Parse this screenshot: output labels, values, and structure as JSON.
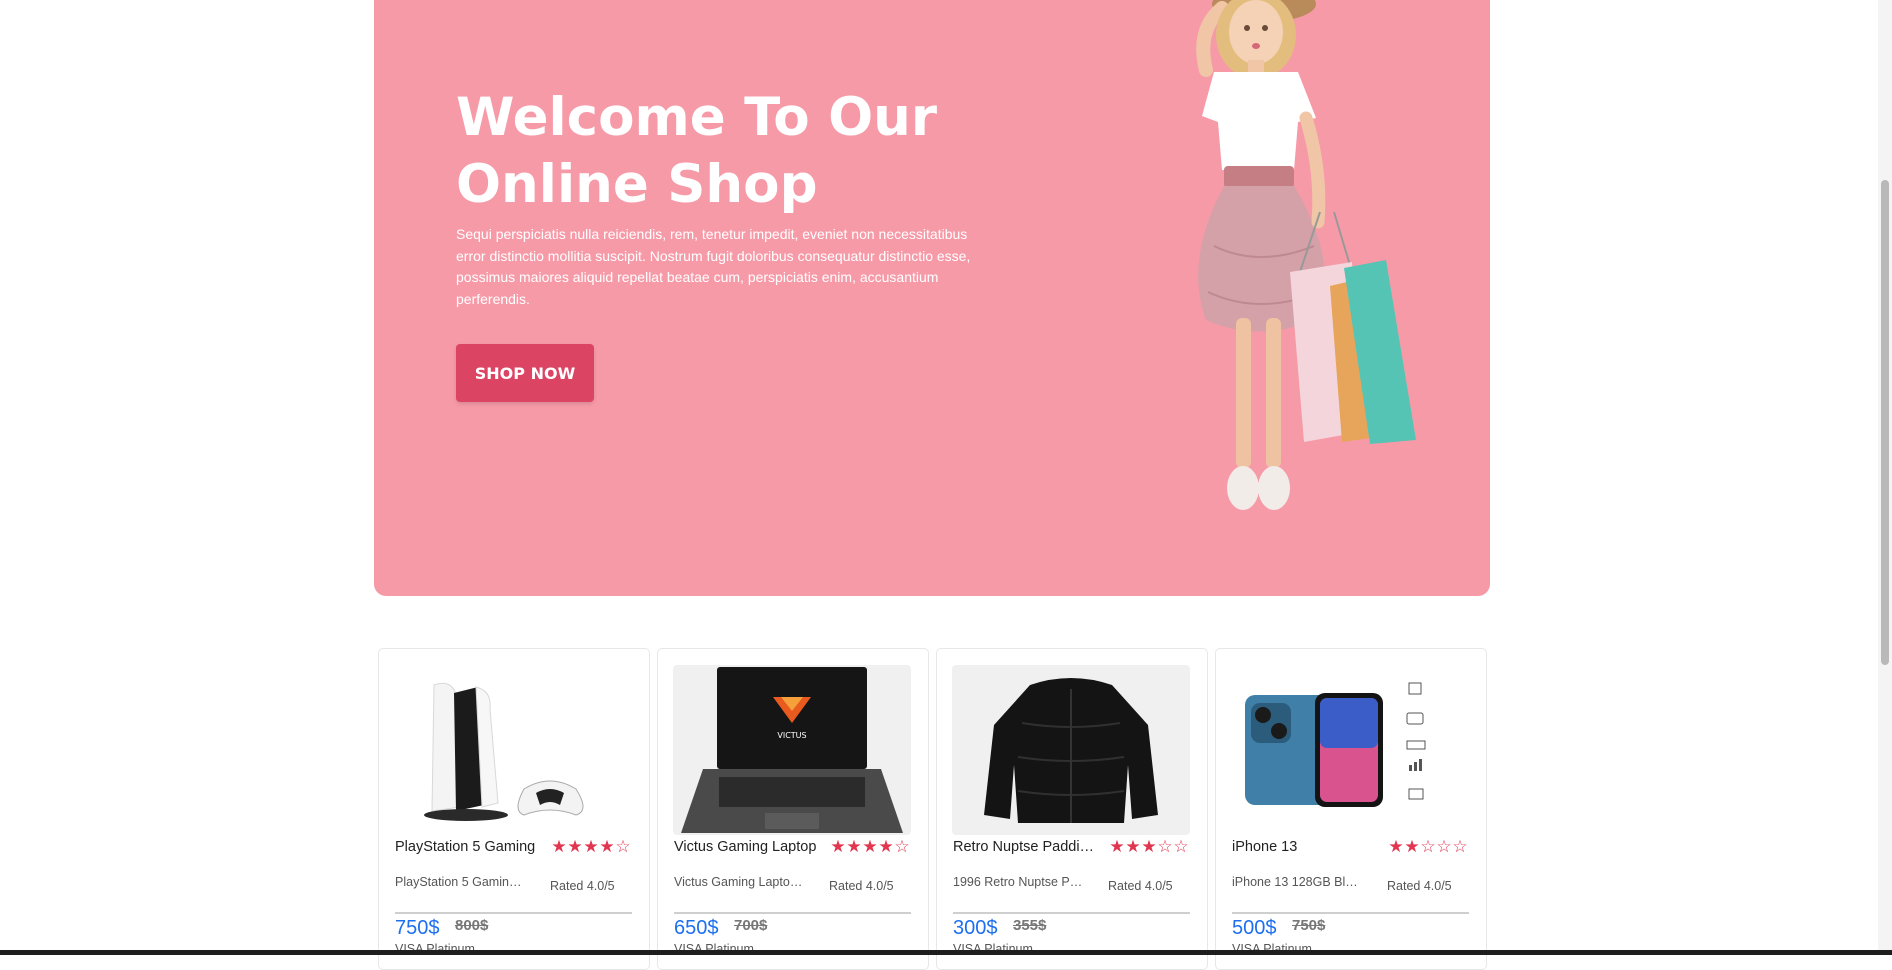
{
  "hero": {
    "title": "Welcome To Our Online Shop",
    "description": "Sequi perspiciatis nulla reiciendis, rem, tenetur impedit, eveniet non necessitatibus error distinctio mollitia suscipit. Nostrum fugit doloribus consequatur distinctio esse, possimus maiores aliquid repellat beatae cum, perspiciatis enim, accusantium perferendis.",
    "cta_label": "SHOP NOW",
    "background_color": "#f79aa8",
    "cta_color": "#dc4464"
  },
  "products": [
    {
      "name": "PlayStation 5 Gaming",
      "description": "PlayStation 5 Gaming...",
      "rating_stars": 4,
      "rated_label": "Rated 4.0/5",
      "price": "750$",
      "old_price": "800$",
      "payment": "VISA Platinum",
      "image_icon": "playstation-5-image"
    },
    {
      "name": "Victus Gaming Laptop",
      "description": "Victus Gaming Laptop...",
      "rating_stars": 4,
      "rated_label": "Rated 4.0/5",
      "price": "650$",
      "old_price": "700$",
      "payment": "VISA Platinum",
      "image_icon": "laptop-image",
      "image_text": "VICTUS"
    },
    {
      "name": "Retro Nuptse Padding...",
      "description": "1996 Retro Nuptse Pa...",
      "rating_stars": 3,
      "rated_label": "Rated 4.0/5",
      "price": "300$",
      "old_price": "355$",
      "payment": "VISA Platinum",
      "image_icon": "puffer-jacket-image"
    },
    {
      "name": "iPhone 13",
      "description": "iPhone 13 128GB Blue...",
      "rating_stars": 2,
      "rated_label": "Rated 4.0/5",
      "price": "500$",
      "old_price": "750$",
      "payment": "VISA Platinum",
      "image_icon": "iphone-image"
    }
  ],
  "colors": {
    "star": "#e0364f",
    "price": "#1d6ff0"
  }
}
